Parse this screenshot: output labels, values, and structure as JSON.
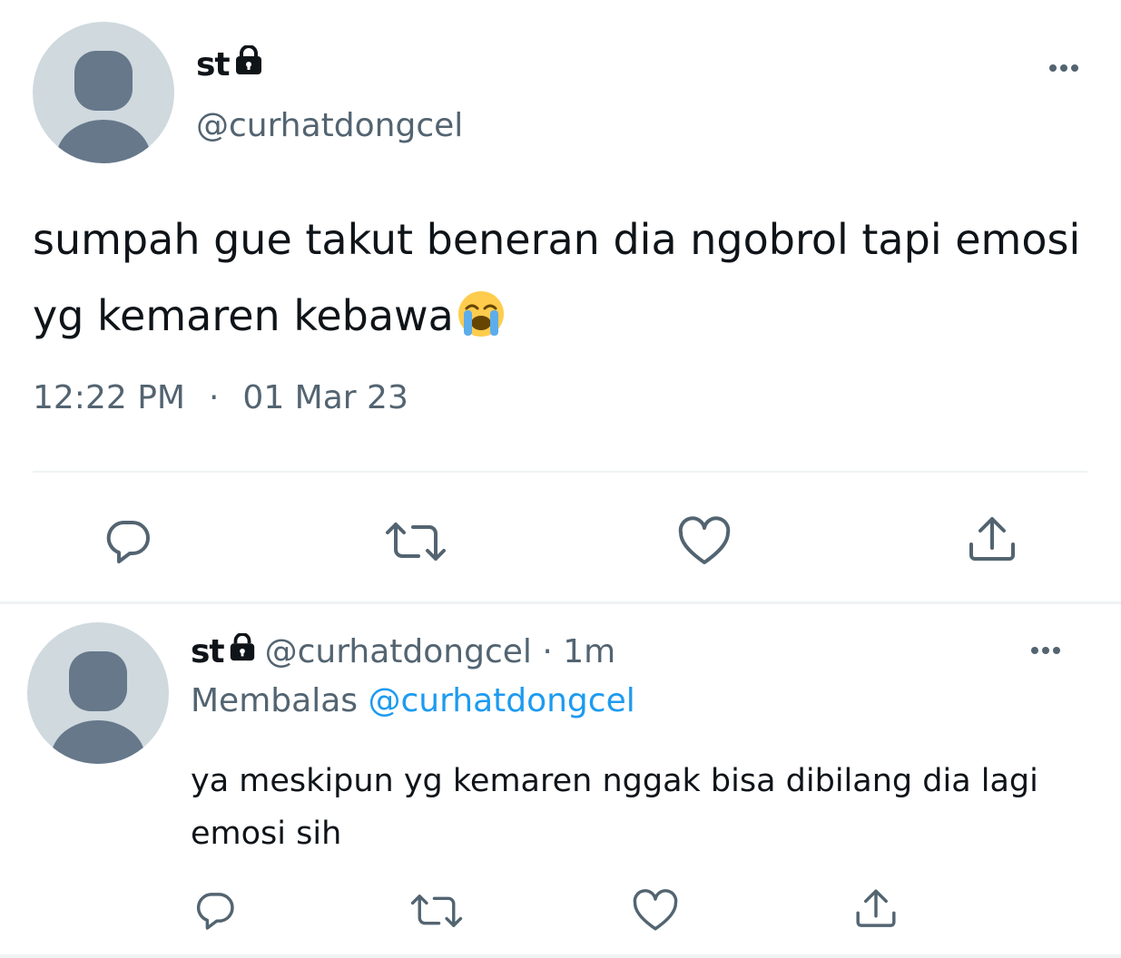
{
  "main_tweet": {
    "display_name": "st",
    "handle": "@curhatdongcel",
    "text": "sumpah gue takut beneran dia ngobrol tapi emosi yg kemaren kebawa",
    "emoji": "😭",
    "time": "12:22 PM",
    "separator": "·",
    "date": "01 Mar 23",
    "actions": [
      "reply-icon",
      "retweet-icon",
      "like-icon",
      "share-icon"
    ]
  },
  "reply_tweet": {
    "display_name": "st",
    "handle_meta": "@curhatdongcel · 1m",
    "replying_label": "Membalas",
    "replying_to": "@curhatdongcel",
    "text": "ya meskipun yg kemaren nggak bisa dibilang dia lagi emosi sih",
    "actions": [
      "reply-icon",
      "retweet-icon",
      "like-icon",
      "share-icon"
    ]
  },
  "colors": {
    "text_primary": "#0f1419",
    "text_secondary": "#536471",
    "link": "#1d9bf0",
    "divider": "#eff3f4",
    "avatar_bg": "#cfd9de",
    "avatar_fg": "#66788a"
  }
}
